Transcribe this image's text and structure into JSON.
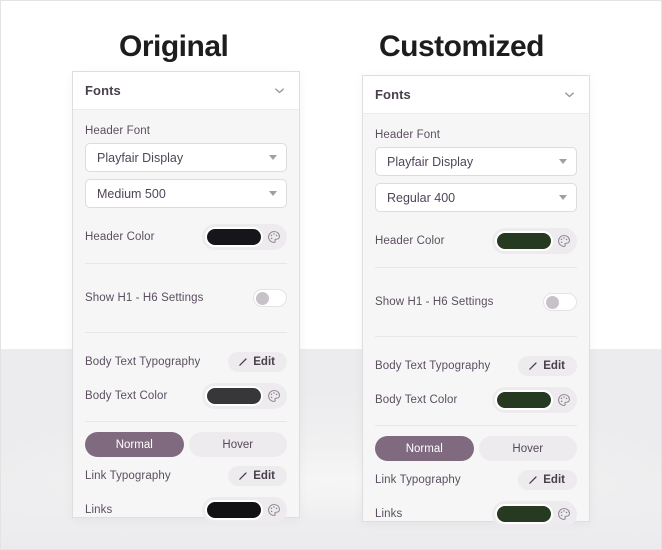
{
  "titles": {
    "original": "Original",
    "customized": "Customized"
  },
  "colors": {
    "header_color_original": "#16161a",
    "header_color_customized": "#253a20",
    "body_text_color_original": "#37373a",
    "body_text_color_customized": "#253a20",
    "links_color_original": "#121214",
    "links_color_customized": "#253a20",
    "tab_active": "#806a80",
    "panel_bg": "#f6f6f7",
    "panel_border": "#dededf"
  },
  "panels": [
    {
      "id": "original",
      "header": {
        "title": "Fonts",
        "collapse_icon": "chevron-down-icon"
      },
      "header_font_label": "Header Font",
      "font_family_select": {
        "value": "Playfair Display",
        "caret_icon": "caret-down-icon"
      },
      "font_weight_select": {
        "value": "Medium 500",
        "caret_icon": "caret-down-icon"
      },
      "header_color": {
        "label": "Header Color",
        "value": "#16161a",
        "picker_icon": "palette-icon"
      },
      "show_h1_h6": {
        "label": "Show H1 - H6 Settings",
        "state": "off"
      },
      "body_text_typography": {
        "label": "Body Text Typography",
        "button_label": "Edit",
        "button_icon": "pencil-icon"
      },
      "body_text_color": {
        "label": "Body Text Color",
        "value": "#37373a",
        "picker_icon": "palette-icon"
      },
      "state_tabs": [
        {
          "label": "Normal",
          "active": true
        },
        {
          "label": "Hover",
          "active": false
        }
      ],
      "link_typography": {
        "label": "Link Typography",
        "button_label": "Edit",
        "button_icon": "pencil-icon"
      },
      "links_color": {
        "label": "Links",
        "value": "#121214",
        "picker_icon": "palette-icon"
      }
    },
    {
      "id": "customized",
      "header": {
        "title": "Fonts",
        "collapse_icon": "chevron-down-icon"
      },
      "header_font_label": "Header Font",
      "font_family_select": {
        "value": "Playfair Display",
        "caret_icon": "caret-down-icon"
      },
      "font_weight_select": {
        "value": "Regular 400",
        "caret_icon": "caret-down-icon"
      },
      "header_color": {
        "label": "Header Color",
        "value": "#253a20",
        "picker_icon": "palette-icon"
      },
      "show_h1_h6": {
        "label": "Show H1 - H6 Settings",
        "state": "off"
      },
      "body_text_typography": {
        "label": "Body Text Typography",
        "button_label": "Edit",
        "button_icon": "pencil-icon"
      },
      "body_text_color": {
        "label": "Body Text Color",
        "value": "#253a20",
        "picker_icon": "palette-icon"
      },
      "state_tabs": [
        {
          "label": "Normal",
          "active": true
        },
        {
          "label": "Hover",
          "active": false
        }
      ],
      "link_typography": {
        "label": "Link Typography",
        "button_label": "Edit",
        "button_icon": "pencil-icon"
      },
      "links_color": {
        "label": "Links",
        "value": "#253a20",
        "picker_icon": "palette-icon"
      }
    }
  ]
}
